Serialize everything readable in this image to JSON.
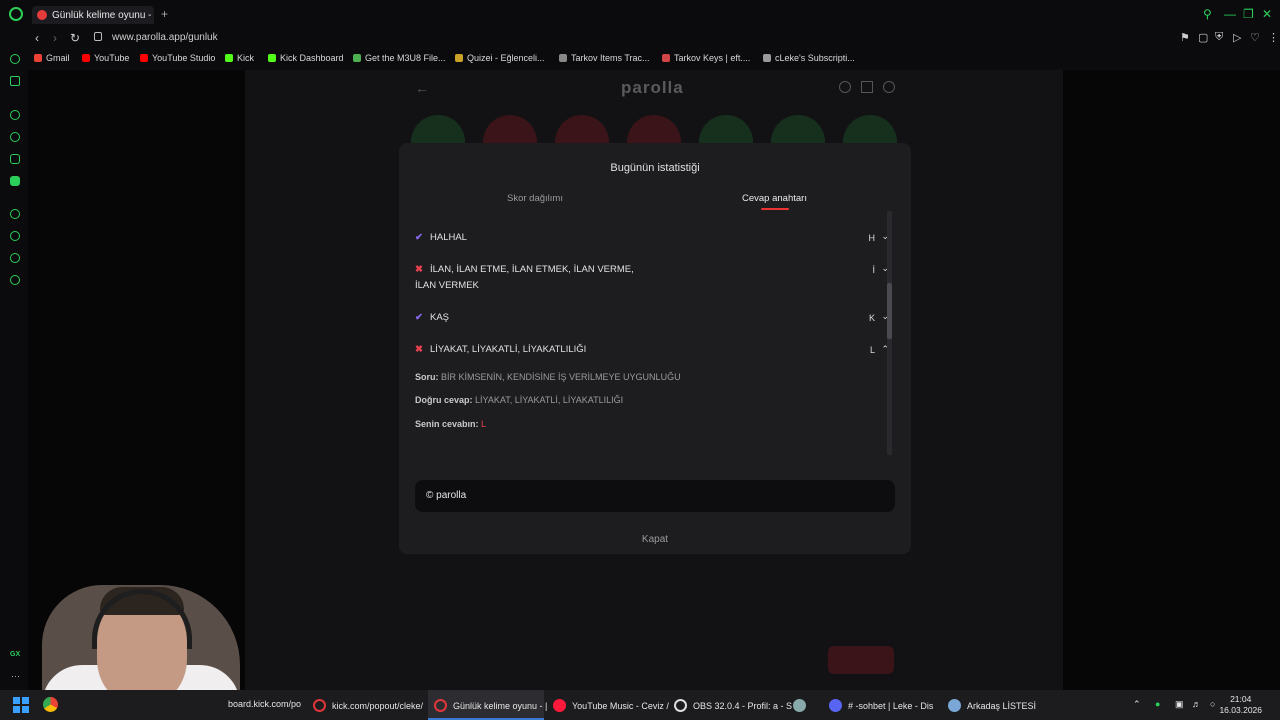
{
  "browser": {
    "tab_title": "Günlük kelime oyunu - par",
    "new_tab": "+",
    "url": "www.parolla.app/gunluk",
    "bookmarks": [
      {
        "label": "Gmail",
        "color": "#ea4335"
      },
      {
        "label": "YouTube",
        "color": "#ff0000"
      },
      {
        "label": "YouTube Studio",
        "color": "#ff0000"
      },
      {
        "label": "Kick",
        "color": "#53fc18"
      },
      {
        "label": "Kick Dashboard",
        "color": "#53fc18"
      },
      {
        "label": "Get the M3U8 File...",
        "color": "#4caf50"
      },
      {
        "label": "Quizei - Eğlenceli...",
        "color": "#c9a227"
      },
      {
        "label": "Tarkov Items Trac...",
        "color": "#888888"
      },
      {
        "label": "Tarkov Keys | eft....",
        "color": "#d04545"
      },
      {
        "label": "cLeke's Subscripti...",
        "color": "#999999"
      }
    ]
  },
  "app": {
    "logo": "parolla",
    "accent": "#e33b3b"
  },
  "modal": {
    "title": "Bugünün istatistiği",
    "tab_distribution": "Skor dağılımı",
    "tab_answers": "Cevap anahtarı",
    "rows": [
      {
        "status": "correct",
        "text": "HALHAL",
        "letter": "H",
        "chevron": "v"
      },
      {
        "status": "wrong",
        "text": "İLAN, İLAN ETME, İLAN ETMEK, İLAN VERME,",
        "text2": "İLAN VERMEK",
        "letter": "İ",
        "chevron": "v"
      },
      {
        "status": "correct",
        "text": "KAŞ",
        "letter": "K",
        "chevron": "v"
      },
      {
        "status": "wrong",
        "text": "LİYAKAT, LİYAKATLİ, LİYAKATLILIĞI",
        "letter": "L",
        "chevron": "^"
      }
    ],
    "detail": {
      "question_label": "Soru:",
      "question": "BİR KİMSENİN, KENDİSİNE İŞ VERİLMEYE UYGUNLUĞU",
      "correct_label": "Doğru cevap:",
      "correct": "LİYAKAT, LİYAKATLİ, LİYAKATLILIĞI",
      "yours_label": "Senin cevabın:",
      "yours": "L"
    },
    "footer": "© parolla",
    "close": "Kapat"
  },
  "taskbar": {
    "items": [
      {
        "label": "board.kick.com/po",
        "color": "#2b2b2b"
      },
      {
        "label": "kick.com/popout/cleke/",
        "color": "#e0363a"
      },
      {
        "label": "Günlük kelime oyunu - |",
        "color": "#e0363a"
      },
      {
        "label": "YouTube Music - Ceviz /",
        "color": "#ff1a3c"
      },
      {
        "label": "OBS 32.0.4 - Profil: a - S",
        "color": "#dddddd"
      },
      {
        "label": "# -sohbet | Leke - Dis",
        "color": "#5865f2"
      },
      {
        "label": "Arkadaş LİSTESİ",
        "color": "#7aa7d6"
      }
    ],
    "time": "21:04",
    "date": "16.03.2026"
  }
}
